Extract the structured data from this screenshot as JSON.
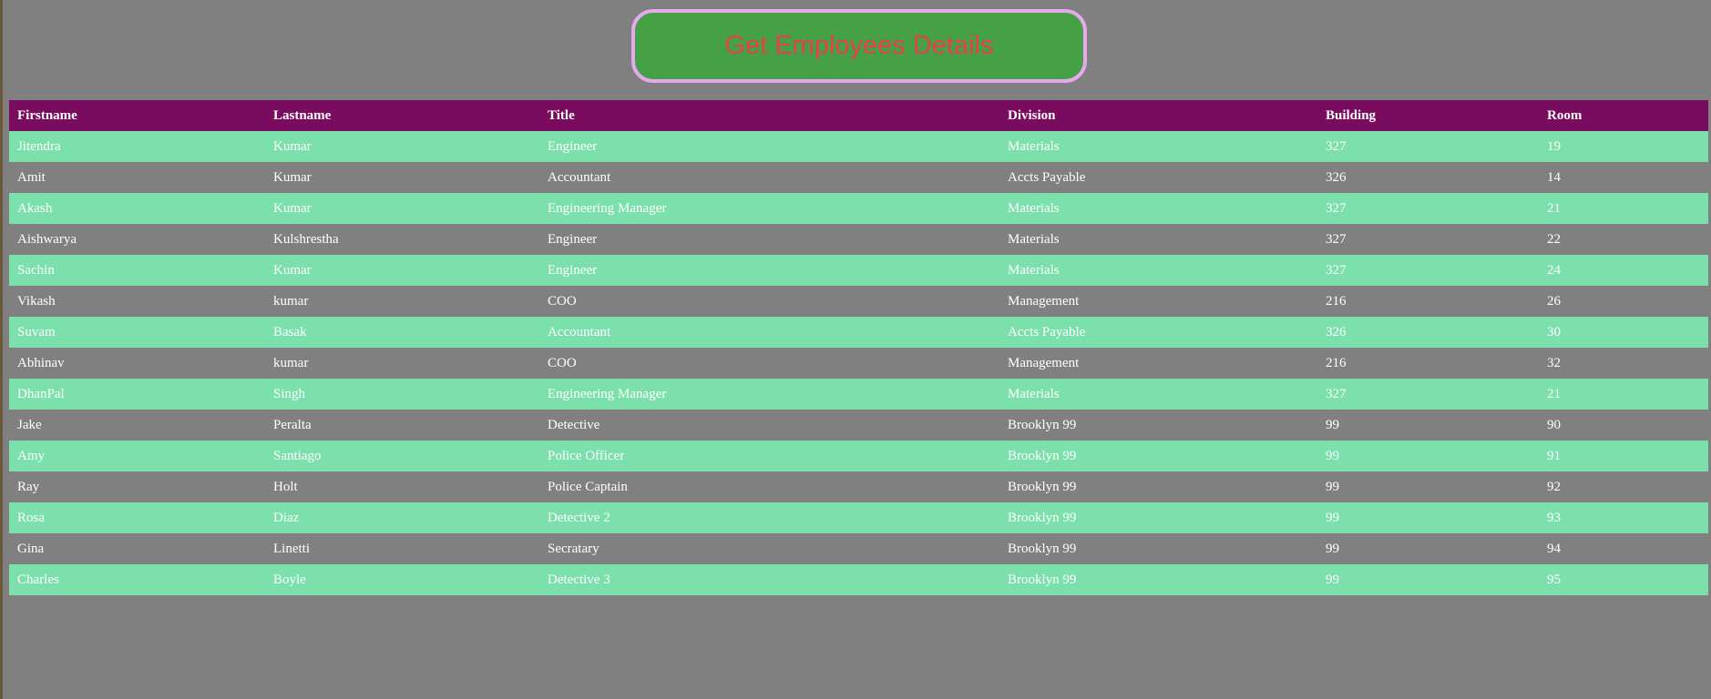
{
  "button": {
    "label": "Get Employees Details"
  },
  "colors": {
    "page_background": "#808080",
    "button_background": "#46a046",
    "button_border": "#e8a8ee",
    "button_text": "#e8404a",
    "header_background": "#7a0c60",
    "row_highlight": "#7ce0ac",
    "text": "#ffffff"
  },
  "table": {
    "headers": [
      "Firstname",
      "Lastname",
      "Title",
      "Division",
      "Building",
      "Room"
    ],
    "rows": [
      [
        "Jitendra",
        "Kumar",
        "Engineer",
        "Materials",
        "327",
        "19"
      ],
      [
        "Amit",
        "Kumar",
        "Accountant",
        "Accts Payable",
        "326",
        "14"
      ],
      [
        "Akash",
        "Kumar",
        "Engineering Manager",
        "Materials",
        "327",
        "21"
      ],
      [
        "Aishwarya",
        "Kulshrestha",
        "Engineer",
        "Materials",
        "327",
        "22"
      ],
      [
        "Sachin",
        "Kumar",
        "Engineer",
        "Materials",
        "327",
        "24"
      ],
      [
        "Vikash",
        "kumar",
        "COO",
        "Management",
        "216",
        "26"
      ],
      [
        "Suvam",
        "Basak",
        "Accountant",
        "Accts Payable",
        "326",
        "30"
      ],
      [
        "Abhinav",
        "kumar",
        "COO",
        "Management",
        "216",
        "32"
      ],
      [
        "DhanPal",
        "Singh",
        "Engineering Manager",
        "Materials",
        "327",
        "21"
      ],
      [
        "Jake",
        "Peralta",
        "Detective",
        "Brooklyn 99",
        "99",
        "90"
      ],
      [
        "Amy",
        "Santiago",
        "Police Officer",
        "Brooklyn 99",
        "99",
        "91"
      ],
      [
        "Ray",
        "Holt",
        "Police Captain",
        "Brooklyn 99",
        "99",
        "92"
      ],
      [
        "Rosa",
        "Diaz",
        "Detective 2",
        "Brooklyn 99",
        "99",
        "93"
      ],
      [
        "Gina",
        "Linetti",
        "Secratary",
        "Brooklyn 99",
        "99",
        "94"
      ],
      [
        "Charles",
        "Boyle",
        "Detective 3",
        "Brooklyn 99",
        "99",
        "95"
      ]
    ]
  }
}
